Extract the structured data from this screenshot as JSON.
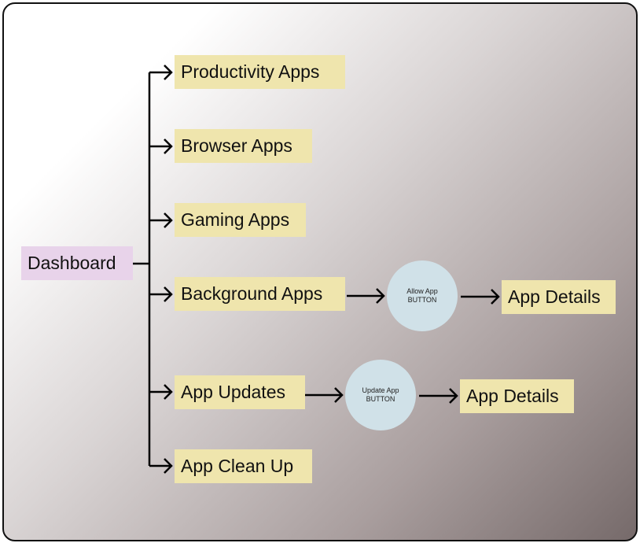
{
  "nodes": {
    "dashboard": "Dashboard",
    "productivity": "Productivity Apps",
    "browser": "Browser Apps",
    "gaming": "Gaming Apps",
    "background": "Background Apps",
    "updates": "App Updates",
    "cleanup": "App Clean Up",
    "allow_button": {
      "line1": "Allow App",
      "line2": "BUTTON"
    },
    "update_button": {
      "line1": "Update App",
      "line2": "BUTTON"
    },
    "details_1": "App Details",
    "details_2": "App Details"
  },
  "colors": {
    "category_box": "#efe5ad",
    "root_box": "#e8d3ea",
    "button_circle": "#d0e1e8"
  }
}
